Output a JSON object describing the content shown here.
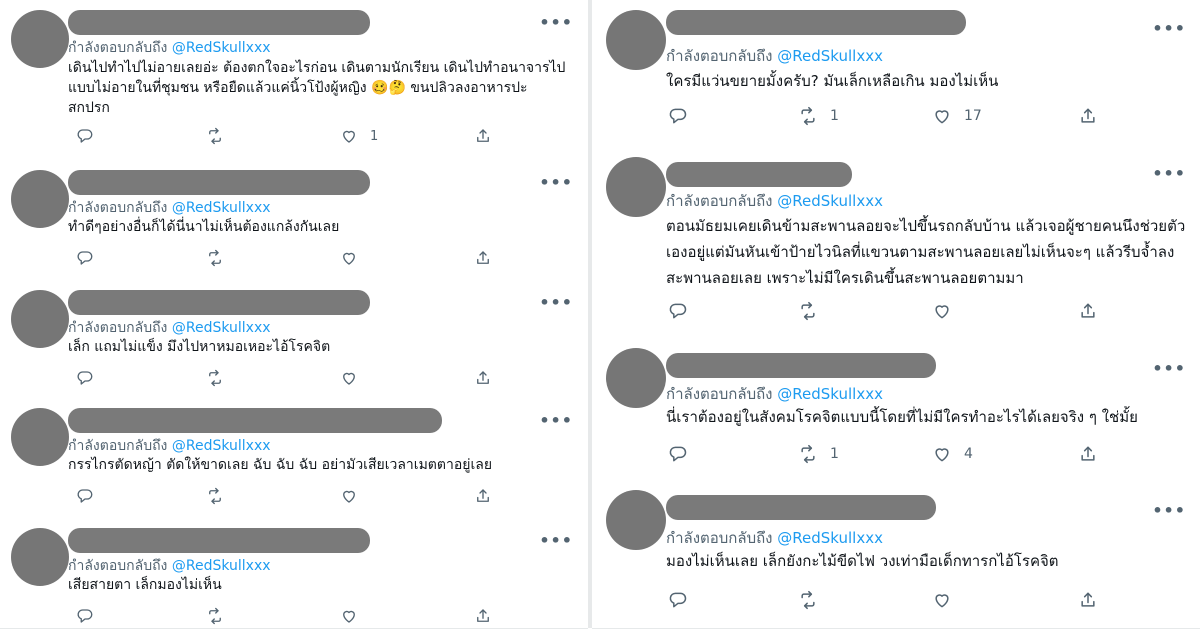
{
  "reply_prefix": "กำลังตอบกลับถึง",
  "reply_handle": "@RedSkullxxx",
  "more_glyph": "•••",
  "colors": {
    "handle": "#1d9bf0",
    "muted": "#536471",
    "redaction": "#777777"
  },
  "left_tweets": [
    {
      "lines": [
        "เดินไปทำไปไม่อายเลยอ่ะ ต้องตกใจอะไรก่อน เดินตามนักเรียน เดินไปทำอนาจารไป",
        "แบบไม่อายในที่ชุมชน หรือยืดแล้วแค่นิ้วโป้งผู้หญิง 🥴🤔 ขนปลิวลงอาหารปะ",
        "สกปรก"
      ],
      "replies": "",
      "retweets": "",
      "likes": "1"
    },
    {
      "lines": [
        "ทำดีๆอย่างอื่นก็ได้นี่นาไม่เห็นต้องแกล้งกันเลย"
      ],
      "replies": "",
      "retweets": "",
      "likes": ""
    },
    {
      "lines": [
        "เล็ก แถมไม่แข็ง มึงไปหาหมอเหอะไอ้โรคจิต"
      ],
      "replies": "",
      "retweets": "",
      "likes": ""
    },
    {
      "lines": [
        "กรรไกรตัดหญ้า ตัดให้ขาดเลย ฉับ ฉับ ฉับ อย่ามัวเสียเวลาเมตตาอยู่เลย"
      ],
      "replies": "",
      "retweets": "",
      "likes": ""
    },
    {
      "lines": [
        "เสียสายตา เล็กมองไม่เห็น"
      ],
      "replies": "",
      "retweets": "",
      "likes": ""
    }
  ],
  "right_tweets": [
    {
      "lines": [
        "ใครมีแว่นขยายมั้งครับ? มันเล็กเหลือเกิน มองไม่เห็น"
      ],
      "replies": "",
      "retweets": "1",
      "likes": "17"
    },
    {
      "lines": [
        "ตอนมัธยมเคยเดินข้ามสะพานลอยจะไปขึ้นรถกลับบ้าน แล้วเจอผู้ชายคนนึงช่วยตัว",
        "เองอยู่แต่มันหันเข้าป้ายไวนิลที่แขวนตามสะพานลอยเลยไม่เห็นจะๆ แล้วรีบจ้ำลง",
        "สะพานลอยเลย เพราะไม่มีใครเดินขึ้นสะพานลอยตามมา"
      ],
      "replies": "",
      "retweets": "",
      "likes": ""
    },
    {
      "lines": [
        "นี่เราต้องอยู่ในสังคมโรคจิตแบบนี้โดยที่ไม่มีใครทำอะไรได้เลยจริง ๆ ใช่มั้ย"
      ],
      "replies": "",
      "retweets": "1",
      "likes": "4"
    },
    {
      "lines": [
        "มองไม่เห็นเลย เล็กยังกะไม้ขีดไฟ วงเท่ามือเด็กทารกไอ้โรคจิต"
      ],
      "replies": "",
      "retweets": "",
      "likes": ""
    }
  ]
}
